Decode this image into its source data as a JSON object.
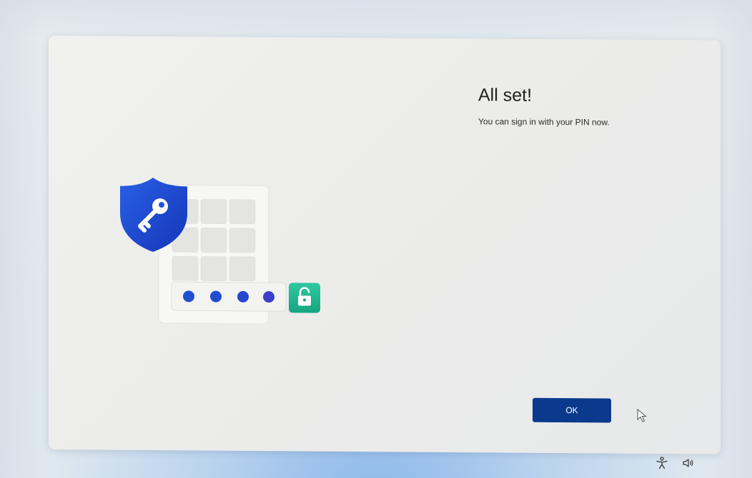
{
  "dialog": {
    "title": "All set!",
    "subtitle": "You can sign in with your PIN now.",
    "ok_label": "OK"
  },
  "illustration": {
    "pin_dot_count": 4,
    "icons": [
      "shield-key-icon",
      "keypad-icon",
      "unlock-icon"
    ]
  },
  "system_tray": {
    "icons": [
      "accessibility-icon",
      "volume-icon"
    ]
  },
  "colors": {
    "accent": "#0b3a8c",
    "shield": "#1e4fd6",
    "pin_dot": "#1f4fd1",
    "unlock": "#1fb58f"
  }
}
